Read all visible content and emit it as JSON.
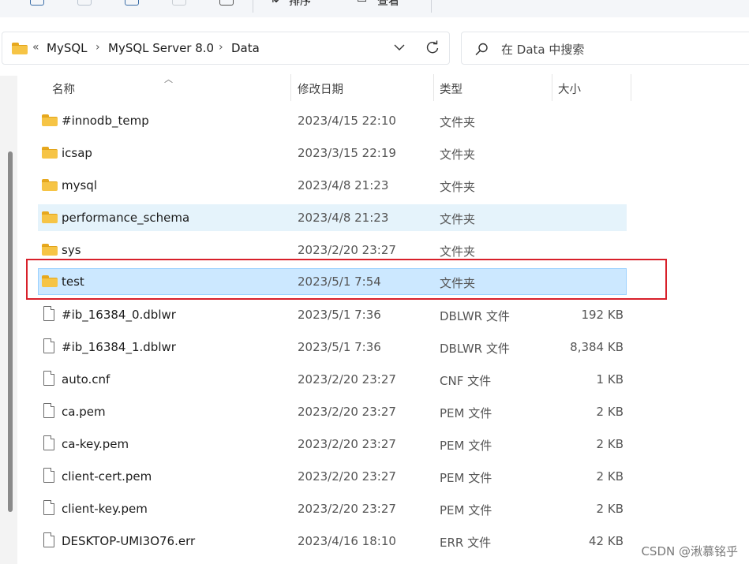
{
  "toolbar": {
    "sort_label": "排序",
    "view_label": "查看"
  },
  "address": {
    "overflow": "«",
    "crumbs": [
      "MySQL",
      "MySQL Server 8.0",
      "Data"
    ]
  },
  "search": {
    "placeholder": "在 Data 中搜索"
  },
  "columns": {
    "name": "名称",
    "date": "修改日期",
    "type": "类型",
    "size": "大小"
  },
  "files": [
    {
      "name": "#innodb_temp",
      "date": "2023/4/15 22:10",
      "type": "文件夹",
      "size": "",
      "icon": "folder-icon",
      "state": ""
    },
    {
      "name": "icsap",
      "date": "2023/3/15 22:19",
      "type": "文件夹",
      "size": "",
      "icon": "folder-icon",
      "state": ""
    },
    {
      "name": "mysql",
      "date": "2023/4/8 21:23",
      "type": "文件夹",
      "size": "",
      "icon": "folder-icon",
      "state": ""
    },
    {
      "name": "performance_schema",
      "date": "2023/4/8 21:23",
      "type": "文件夹",
      "size": "",
      "icon": "folder-icon",
      "state": "hover"
    },
    {
      "name": "sys",
      "date": "2023/2/20 23:27",
      "type": "文件夹",
      "size": "",
      "icon": "folder-icon",
      "state": ""
    },
    {
      "name": "test",
      "date": "2023/5/1 7:54",
      "type": "文件夹",
      "size": "",
      "icon": "folder-icon",
      "state": "selected"
    },
    {
      "name": "#ib_16384_0.dblwr",
      "date": "2023/5/1 7:36",
      "type": "DBLWR 文件",
      "size": "192 KB",
      "icon": "file-icon",
      "state": ""
    },
    {
      "name": "#ib_16384_1.dblwr",
      "date": "2023/5/1 7:36",
      "type": "DBLWR 文件",
      "size": "8,384 KB",
      "icon": "file-icon",
      "state": ""
    },
    {
      "name": "auto.cnf",
      "date": "2023/2/20 23:27",
      "type": "CNF 文件",
      "size": "1 KB",
      "icon": "file-icon",
      "state": ""
    },
    {
      "name": "ca.pem",
      "date": "2023/2/20 23:27",
      "type": "PEM 文件",
      "size": "2 KB",
      "icon": "file-icon",
      "state": ""
    },
    {
      "name": "ca-key.pem",
      "date": "2023/2/20 23:27",
      "type": "PEM 文件",
      "size": "2 KB",
      "icon": "file-icon",
      "state": ""
    },
    {
      "name": "client-cert.pem",
      "date": "2023/2/20 23:27",
      "type": "PEM 文件",
      "size": "2 KB",
      "icon": "file-icon",
      "state": ""
    },
    {
      "name": "client-key.pem",
      "date": "2023/2/20 23:27",
      "type": "PEM 文件",
      "size": "2 KB",
      "icon": "file-icon",
      "state": ""
    },
    {
      "name": "DESKTOP-UMI3O76.err",
      "date": "2023/4/16 18:10",
      "type": "ERR 文件",
      "size": "42 KB",
      "icon": "file-icon",
      "state": ""
    }
  ],
  "watermark": "CSDN @湫慕铭乎",
  "colors": {
    "selected_bg": "#cce8ff",
    "hover_bg": "#e5f3fb",
    "highlight_border": "#d8202a",
    "folder": "#f6c445"
  }
}
